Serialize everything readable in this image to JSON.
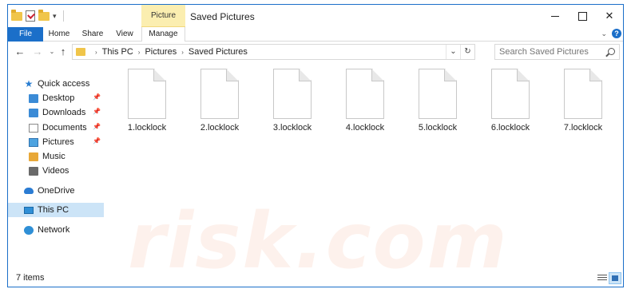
{
  "window": {
    "title": "Saved Pictures",
    "context_tab_group": "Picture Tools",
    "controls": {
      "minimize": "",
      "maximize": "",
      "close": "✕"
    }
  },
  "ribbon": {
    "tabs": [
      "File",
      "Home",
      "Share",
      "View",
      "Manage"
    ],
    "expand": "⌄",
    "help": "?"
  },
  "address": {
    "crumbs": [
      "This PC",
      "Pictures",
      "Saved Pictures"
    ],
    "dropdown": "⌄",
    "refresh": "↻"
  },
  "nav_buttons": {
    "back": "←",
    "forward": "→",
    "recent": "⌄",
    "up": "↑"
  },
  "search": {
    "placeholder": "Search Saved Pictures"
  },
  "sidebar": {
    "quick_access": "Quick access",
    "items": [
      {
        "label": "Desktop",
        "pinned": true
      },
      {
        "label": "Downloads",
        "pinned": true
      },
      {
        "label": "Documents",
        "pinned": true
      },
      {
        "label": "Pictures",
        "pinned": true
      },
      {
        "label": "Music",
        "pinned": false
      },
      {
        "label": "Videos",
        "pinned": false
      }
    ],
    "onedrive": "OneDrive",
    "this_pc": "This PC",
    "network": "Network",
    "pin_glyph": "📌"
  },
  "files": [
    {
      "name": "1.locklock"
    },
    {
      "name": "2.locklock"
    },
    {
      "name": "3.locklock"
    },
    {
      "name": "4.locklock"
    },
    {
      "name": "5.locklock"
    },
    {
      "name": "6.locklock"
    },
    {
      "name": "7.locklock"
    }
  ],
  "status": {
    "item_count": "7 items"
  },
  "watermark": "risk.com",
  "colors": {
    "accent": "#1b6fc9",
    "selection": "#cce4f7",
    "picture_tools": "#fbeeb0"
  }
}
